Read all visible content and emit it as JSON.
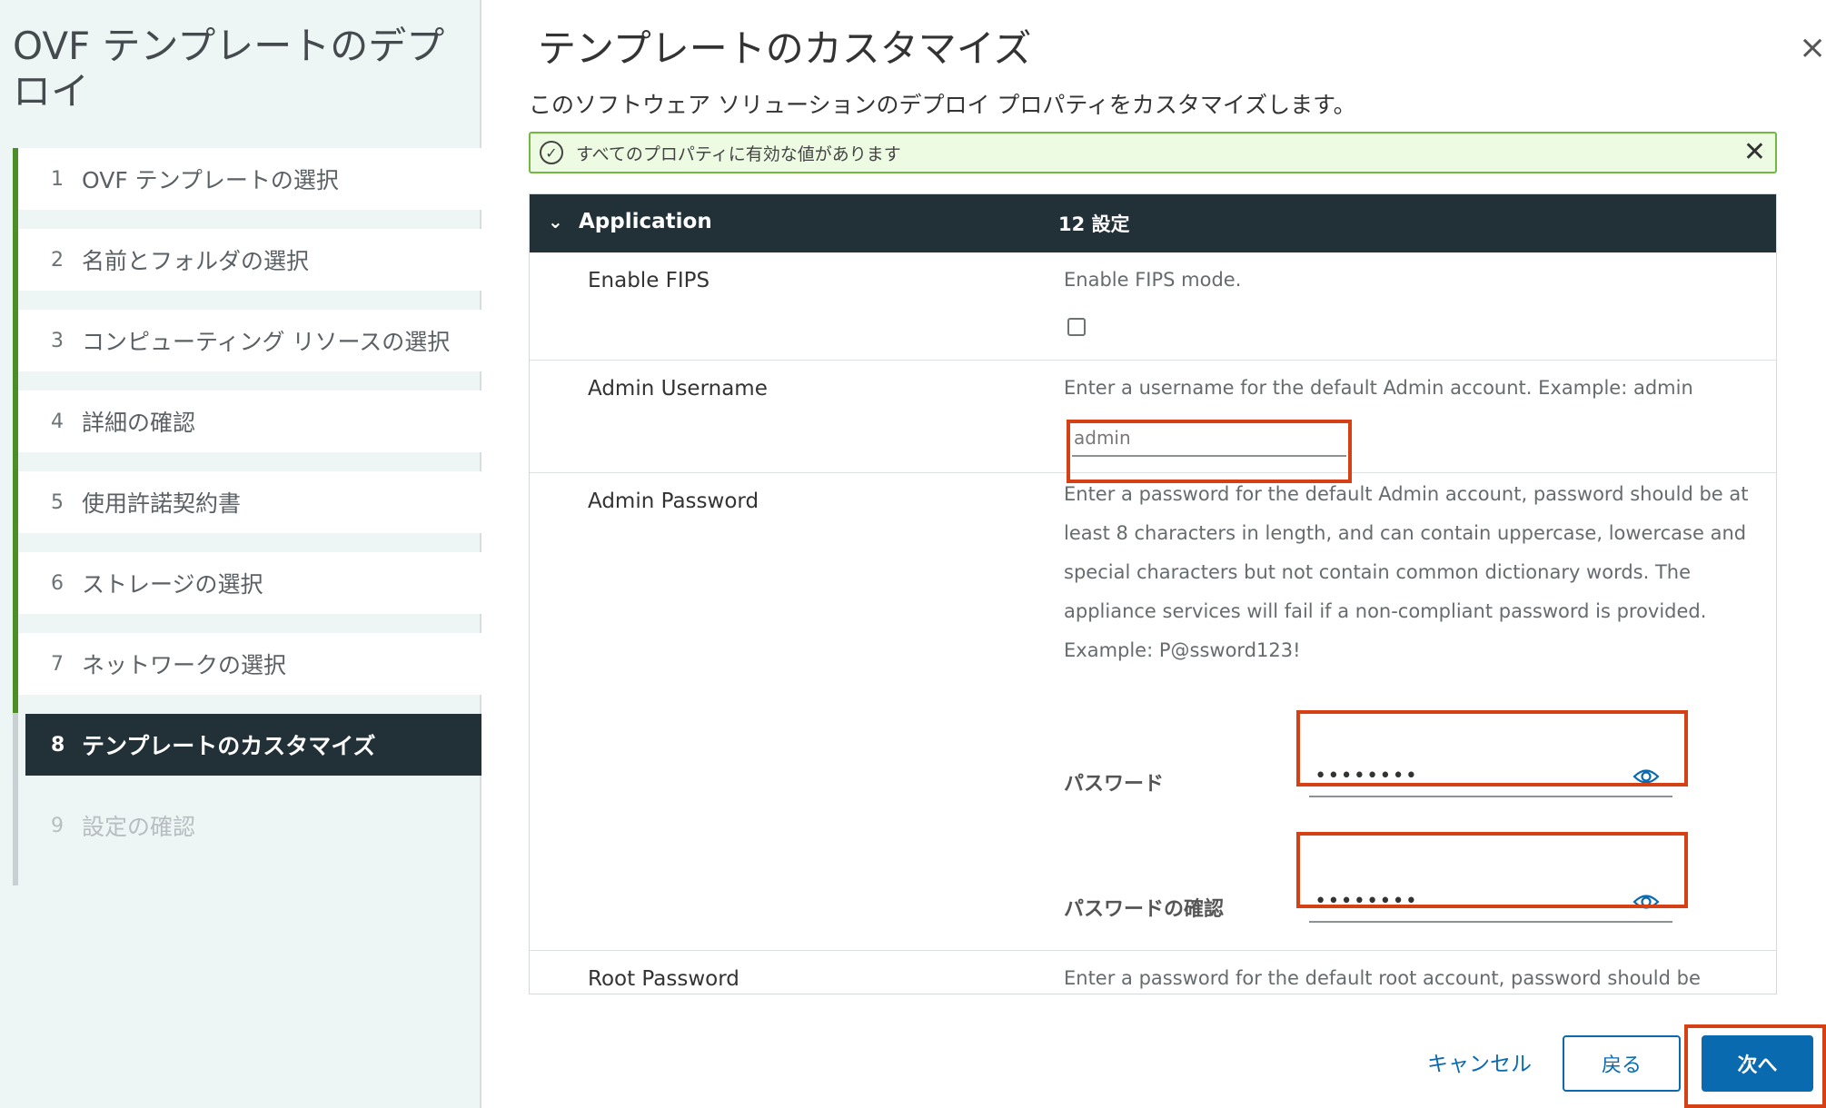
{
  "sidebar": {
    "title": "OVF テンプレートのデプロイ",
    "steps": [
      {
        "num": "1",
        "label": "OVF テンプレートの選択",
        "state": "done"
      },
      {
        "num": "2",
        "label": "名前とフォルダの選択",
        "state": "done"
      },
      {
        "num": "3",
        "label": "コンピューティング リソースの選択",
        "state": "done"
      },
      {
        "num": "4",
        "label": "詳細の確認",
        "state": "done"
      },
      {
        "num": "5",
        "label": "使用許諾契約書",
        "state": "done"
      },
      {
        "num": "6",
        "label": "ストレージの選択",
        "state": "done"
      },
      {
        "num": "7",
        "label": "ネットワークの選択",
        "state": "done"
      },
      {
        "num": "8",
        "label": "テンプレートのカスタマイズ",
        "state": "active"
      },
      {
        "num": "9",
        "label": "設定の確認",
        "state": "disabled"
      }
    ]
  },
  "main": {
    "title": "テンプレートのカスタマイズ",
    "subtitle": "このソフトウェア ソリューションのデプロイ プロパティをカスタマイズします。",
    "close_glyph": "×"
  },
  "alert": {
    "text": "すべてのプロパティに有効な値があります",
    "close_glyph": "✕"
  },
  "panel": {
    "group_name": "Application",
    "group_count": "12 設定",
    "fips": {
      "label": "Enable FIPS",
      "desc": "Enable FIPS mode."
    },
    "admin_username": {
      "label": "Admin Username",
      "desc": "Enter a username for the default Admin account. Example: admin",
      "value": "admin"
    },
    "admin_password": {
      "label": "Admin Password",
      "desc": "Enter a password for the default Admin account, password should be at least 8 characters in length, and can contain uppercase, lowercase and special characters but not contain common dictionary words. The appliance services will fail if a non-compliant password is provided. Example: P@ssword123!",
      "password_label": "パスワード",
      "confirm_label": "パスワードの確認",
      "password_mask": "••••••••",
      "confirm_mask": "••••••••"
    },
    "root_password": {
      "label": "Root Password",
      "desc": "Enter a password for the default root account, password should be"
    }
  },
  "footer": {
    "cancel": "キャンセル",
    "back": "戻る",
    "next": "次へ"
  },
  "colors": {
    "accent": "#0a6ab0",
    "header_dark": "#223038",
    "progress_green": "#4a8e28",
    "highlight_red": "#d64015",
    "alert_green_border": "#72b843"
  }
}
